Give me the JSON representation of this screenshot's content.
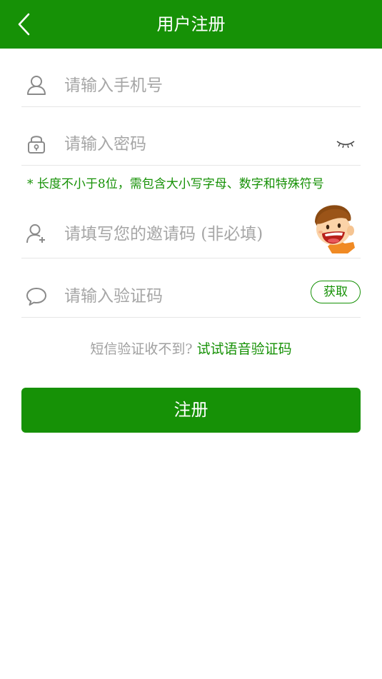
{
  "header": {
    "title": "用户注册",
    "back_icon": "chevron-left-icon",
    "color": "#169106"
  },
  "form": {
    "phone": {
      "placeholder": "请输入手机号",
      "value": "",
      "icon": "user-icon"
    },
    "password": {
      "placeholder": "请输入密码",
      "value": "",
      "icon": "lock-icon",
      "toggle_icon": "eye-closed-icon",
      "hint": "* 长度不小于8位，需包含大小写字母、数字和特殊符号"
    },
    "invite": {
      "placeholder": "请填写您的邀请码 (非必填)",
      "value": "",
      "icon": "user-add-icon",
      "mascot_icon": "cartoon-boy-icon"
    },
    "code": {
      "placeholder": "请输入验证码",
      "value": "",
      "icon": "speech-bubble-icon",
      "get_label": "获取"
    }
  },
  "voice": {
    "prefix": "短信验证收不到?",
    "link": "试试语音验证码"
  },
  "register_label": "注册",
  "colors": {
    "accent": "#169106",
    "placeholder": "#a6a6a6",
    "divider": "#e6e6e6"
  }
}
